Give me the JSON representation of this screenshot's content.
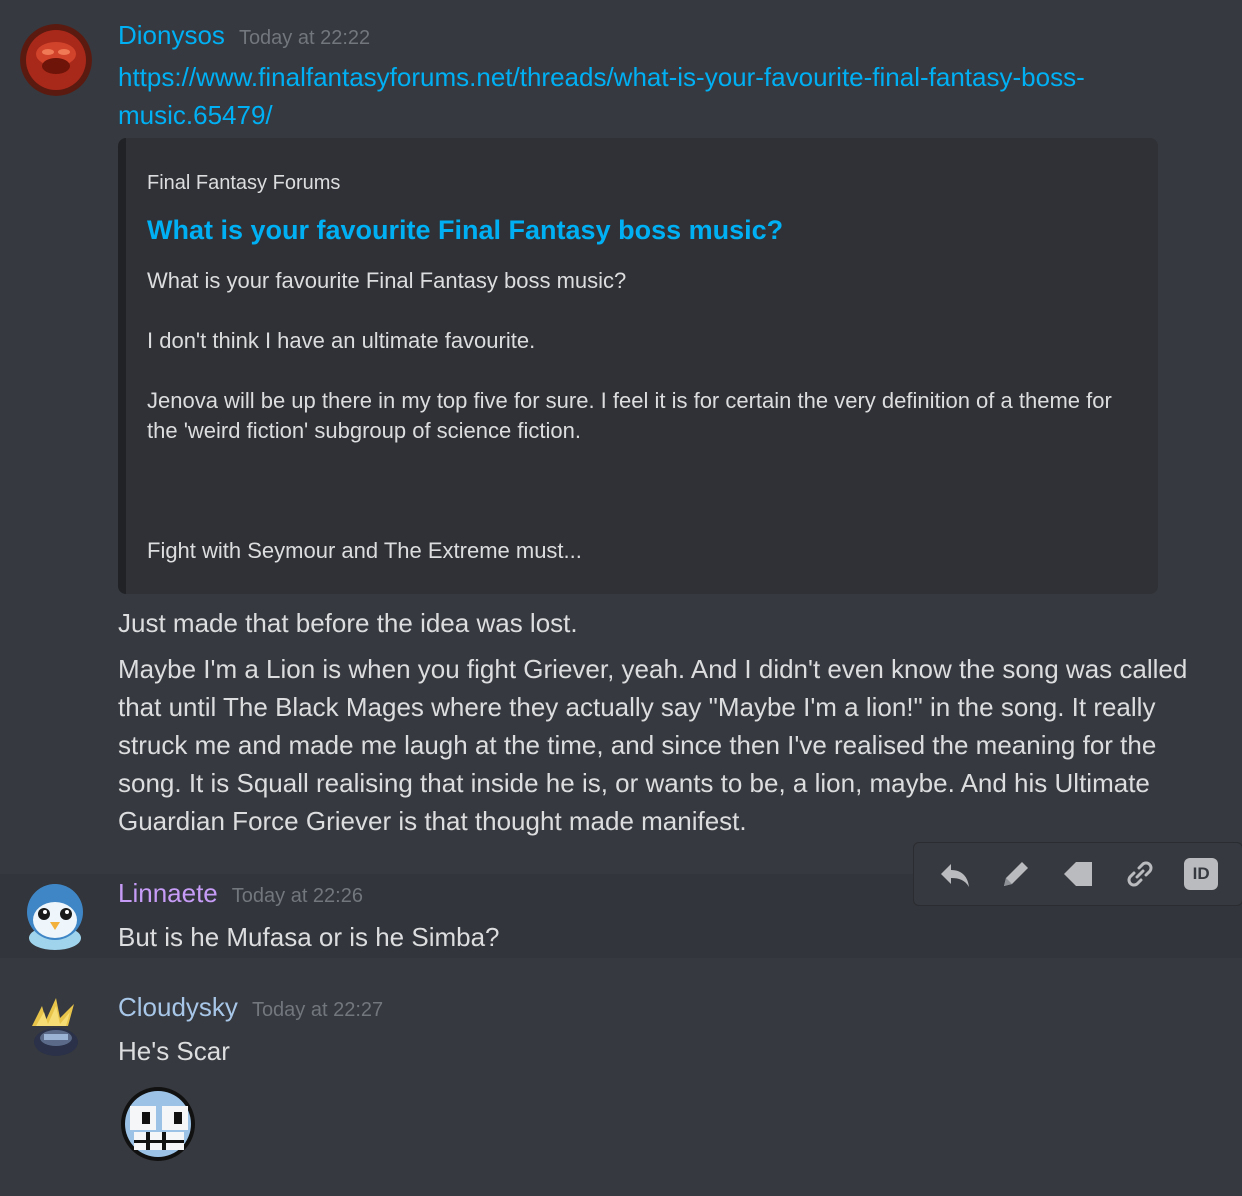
{
  "messages": [
    {
      "username": "Dionysos",
      "username_color": "#00b0f4",
      "timestamp": "Today at 22:22",
      "link": "https://www.finalfantasyforums.net/threads/what-is-your-favourite-final-fantasy-boss-music.65479/",
      "link_line1": "https://www.finalfantasyforums.net/threads/what-is-your-favourite-final-fantasy-boss-",
      "link_line2": "music.65479/",
      "embed": {
        "provider": "Final Fantasy Forums",
        "title": "What is your favourite Final Fantasy boss music?",
        "description": [
          "What is your favourite Final Fantasy boss music?",
          "I don't think I have an ultimate favourite.",
          "Jenova will be up there in my top five for sure. I feel it is for certain the very definition of a theme for the 'weird fiction' subgroup of science fiction.",
          "Fight with Seymour and The Extreme must..."
        ]
      },
      "lines": [
        "Just made that before the idea was lost.",
        "Maybe I'm a Lion is when you fight Griever, yeah. And I didn't even know the song was called that until The Black Mages where they actually say \"Maybe I'm a lion!\" in the song. It really struck me and made me laugh at the time, and since then I've realised the meaning for the song. It is Squall realising that inside he is, or wants to be, a lion, maybe. And his Ultimate Guardian Force Griever is that thought made manifest."
      ]
    },
    {
      "username": "Linnaete",
      "username_color": "#c69cf7",
      "timestamp": "Today at 22:26",
      "text": "But is he Mufasa or is he Simba?"
    },
    {
      "username": "Cloudysky",
      "username_color": "#a8c7e8",
      "timestamp": "Today at 22:27",
      "text": "He's Scar",
      "emoji": "grinning-pixel-emoji"
    }
  ],
  "toolbar": {
    "icons": [
      "reply-icon",
      "edit-pencil-icon",
      "pin-icon",
      "copy-link-icon",
      "copy-id-icon"
    ],
    "id_label": "ID"
  }
}
